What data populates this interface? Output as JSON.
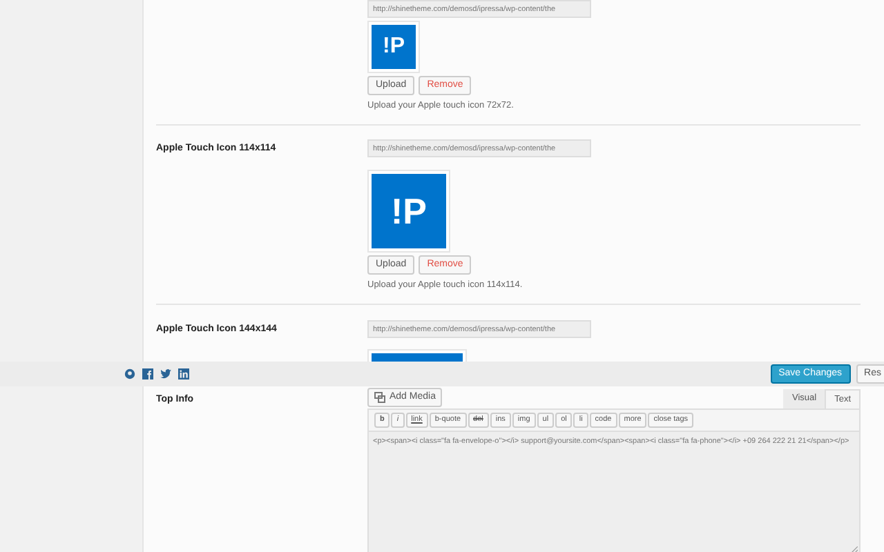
{
  "image_fields": [
    {
      "url": "http://shinetheme.com/demosd/ipressa/wp-content/the",
      "logo_text": "!P",
      "kind": "small",
      "buttons": [
        {
          "label": "Upload",
          "kind": "neutral"
        },
        {
          "label": "Remove",
          "kind": "danger"
        }
      ],
      "description": "Upload your Apple touch icon 72x72."
    },
    {
      "label": "Apple Touch Icon 114x114",
      "url": "http://shinetheme.com/demosd/ipressa/wp-content/the",
      "logo_text": "!P",
      "kind": "large",
      "buttons": [
        {
          "label": "Upload",
          "kind": "neutral"
        },
        {
          "label": "Remove",
          "kind": "danger"
        }
      ],
      "description": "Upload your Apple touch icon 114x114."
    },
    {
      "label": "Apple Touch Icon 144x144",
      "url": "http://shinetheme.com/demosd/ipressa/wp-content/the",
      "kind": "cut"
    }
  ],
  "save_bar": {
    "buttons": [
      {
        "label": "Save Changes",
        "kind": "primary"
      },
      {
        "label": "Res",
        "kind": "neutral"
      }
    ]
  },
  "editor": {
    "label": "Top Info",
    "add_media": "Add Media",
    "tabs": [
      {
        "label": "Visual",
        "selected": false
      },
      {
        "label": "Text",
        "selected": true
      }
    ],
    "quicktags": [
      {
        "label": "b",
        "kind": "bold"
      },
      {
        "label": "i",
        "kind": "italic"
      },
      {
        "label": "link",
        "kind": "link"
      },
      {
        "label": "b-quote",
        "kind": "plain"
      },
      {
        "label": "del",
        "kind": "strike"
      },
      {
        "label": "ins",
        "kind": "plain"
      },
      {
        "label": "img",
        "kind": "plain"
      },
      {
        "label": "ul",
        "kind": "plain"
      },
      {
        "label": "ol",
        "kind": "plain"
      },
      {
        "label": "li",
        "kind": "plain"
      },
      {
        "label": "code",
        "kind": "plain"
      },
      {
        "label": "more",
        "kind": "plain"
      },
      {
        "label": "close tags",
        "kind": "plain"
      }
    ],
    "content": "<p><span><i class=\"fa fa-envelope-o\"></i> support@yoursite.com</span><span><i class=\"fa fa-phone\"></i> +09 264 222 21 21</span></p>"
  }
}
